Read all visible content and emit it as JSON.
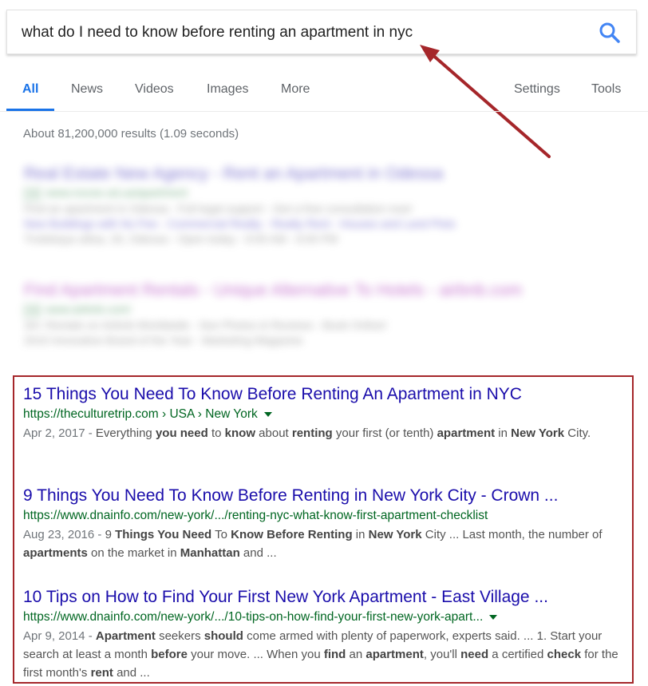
{
  "search": {
    "query": "what do I need to know before renting an apartment in nyc"
  },
  "tabs": {
    "all": "All",
    "news": "News",
    "videos": "Videos",
    "images": "Images",
    "more": "More",
    "settings": "Settings",
    "tools": "Tools"
  },
  "stats": "About 81,200,000 results (1.09 seconds)",
  "ads": [
    {
      "title": "Real Estate New Agency - Rent an Apartment in Odessa",
      "badge": "Ad",
      "url": "www.novoe.od.ua/apartment",
      "desc": "Find an apartment in Odessa - Full legal support - Get a free consultation now!",
      "links": "New Buildings with No Fee - Commercial Realty - Realty Rent - Houses and Land Plots",
      "address": "Troitskaya ulitsa, 33, Odessa - Open today - 9:00 AM - 6:00 PM"
    },
    {
      "title": "Find Apartment Rentals - Unique Alternative To Hotels - airbnb.com",
      "badge": "Ad",
      "url": "www.airbnb.com/",
      "desc": "34+ Rentals on Airbnb Worldwide - See Photos & Reviews - Book Online!",
      "links": "2015 Innovative Brand of the Year - Marketing Magazine"
    }
  ],
  "results": [
    {
      "title": "15 Things You Need To Know Before Renting An Apartment in NYC",
      "url": "https://theculturetrip.com › USA › New York",
      "date": "Apr 2, 2017 - ",
      "snippet_parts": [
        {
          "t": "Everything "
        },
        {
          "b": "you need"
        },
        {
          "t": " to "
        },
        {
          "b": "know"
        },
        {
          "t": " about "
        },
        {
          "b": "renting"
        },
        {
          "t": " your first (or tenth) "
        },
        {
          "b": "apartment"
        },
        {
          "t": " in "
        },
        {
          "b": "New York"
        },
        {
          "t": " City."
        }
      ]
    },
    {
      "title": "9 Things You Need To Know Before Renting in New York City - Crown ...",
      "url": "https://www.dnainfo.com/new-york/.../renting-nyc-what-know-first-apartment-checklist",
      "date": "Aug 23, 2016 - ",
      "snippet_parts": [
        {
          "t": "9 "
        },
        {
          "b": "Things You Need"
        },
        {
          "t": " To "
        },
        {
          "b": "Know Before Renting"
        },
        {
          "t": " in "
        },
        {
          "b": "New York"
        },
        {
          "t": " City ... Last month, the number of "
        },
        {
          "b": "apartments"
        },
        {
          "t": " on the market in "
        },
        {
          "b": "Manhattan"
        },
        {
          "t": " and ..."
        }
      ]
    },
    {
      "title": "10 Tips on How to Find Your First New York Apartment - East Village ...",
      "url": "https://www.dnainfo.com/new-york/.../10-tips-on-how-find-your-first-new-york-apart...",
      "date": "Apr 9, 2014 - ",
      "snippet_parts": [
        {
          "b": "Apartment"
        },
        {
          "t": " seekers "
        },
        {
          "b": "should"
        },
        {
          "t": " come armed with plenty of paperwork, experts said. ... 1. Start your search at least a month "
        },
        {
          "b": "before"
        },
        {
          "t": " your move. ... When you "
        },
        {
          "b": "find"
        },
        {
          "t": " an "
        },
        {
          "b": "apartment"
        },
        {
          "t": ", you'll "
        },
        {
          "b": "need"
        },
        {
          "t": " a certified "
        },
        {
          "b": "check"
        },
        {
          "t": " for the first month's "
        },
        {
          "b": "rent"
        },
        {
          "t": " and ..."
        }
      ]
    }
  ],
  "colors": {
    "link": "#1a0dab",
    "url": "#006621",
    "accent": "#1a73e8",
    "annotation": "#a5262a"
  },
  "icons": {
    "search": "search-icon",
    "dropdown": "caret-down-icon",
    "annotation": "arrow-annotation"
  }
}
